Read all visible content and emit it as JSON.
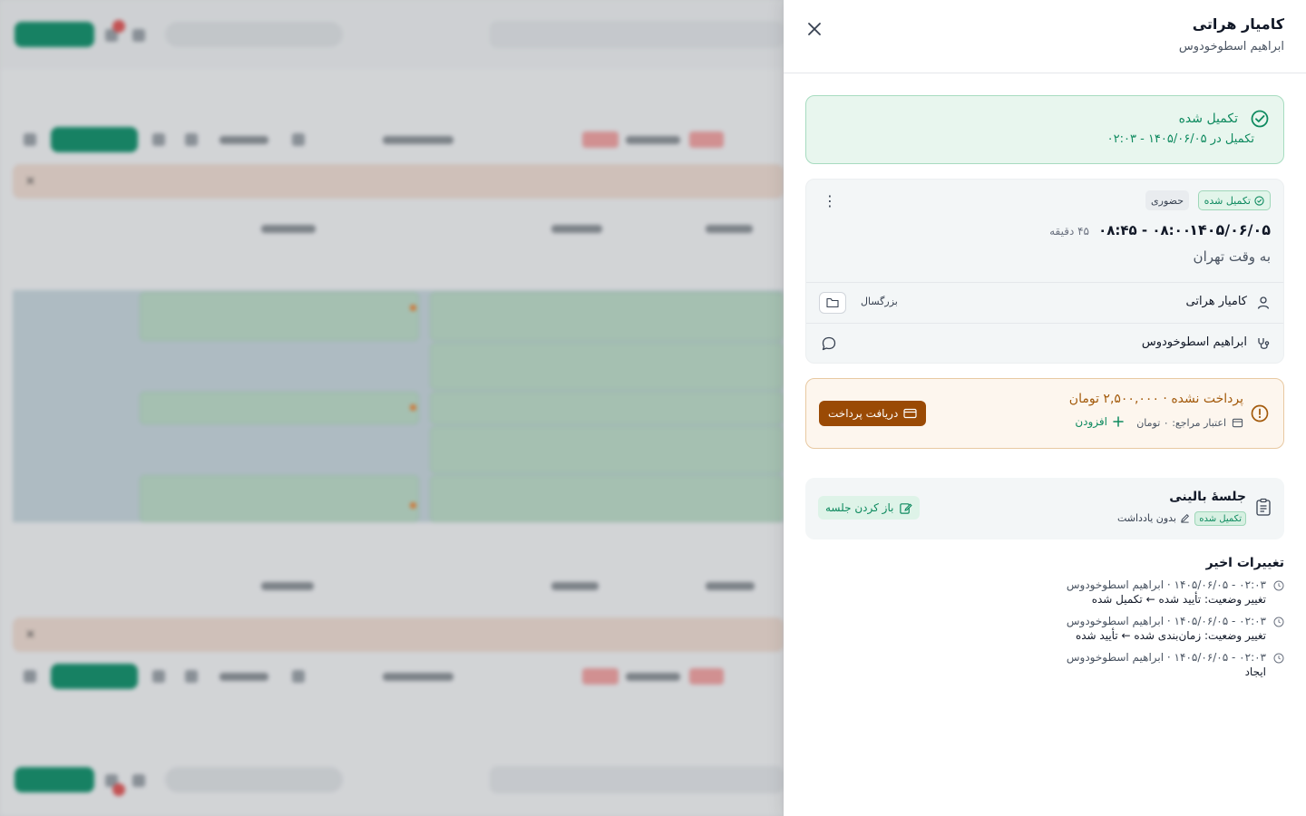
{
  "drawer": {
    "title": "کامیار هراتی",
    "subtitle": "ابراهیم اسطوخودوس"
  },
  "status": {
    "title": "تکمیل شده",
    "subtitle": "تکمیل در ۱۴۰۵/۰۶/۰۵ - ۰۲:۰۳",
    "color": "#0e8a5f"
  },
  "appointment": {
    "status_chip": "تکمیل شده",
    "type_chip": "حضوری",
    "date": "۱۴۰۵/۰۶/۰۵",
    "time": "۰۸:۰۰ - ۰۸:۴۵",
    "duration": "۴۵ دقیقه",
    "timezone": "به وقت تهران",
    "patient_name": "کامیار هراتی",
    "age_group": "بزرگسال",
    "therapist_name": "ابراهیم اسطوخودوس"
  },
  "payment": {
    "title": "پرداخت نشده · ۲,۵۰۰,۰۰۰ تومان",
    "credit": "اعتبار مراجع: ۰ تومان",
    "add_label": "افزودن",
    "receive_label": "دریافت پرداخت",
    "accent": "#9a4a05"
  },
  "session": {
    "title": "جلسهٔ بالینی",
    "status_chip": "تکمیل شده",
    "note": "بدون یادداشت",
    "open_label": "باز کردن جلسه"
  },
  "changes": {
    "title": "تغییرات اخیر",
    "items": [
      {
        "meta": "۰۲:۰۳ - ۱۴۰۵/۰۶/۰۵ · ابراهیم اسطوخودوس",
        "desc": "تغییر وضعیت: تأیید شده ← تکمیل شده"
      },
      {
        "meta": "۰۲:۰۳ - ۱۴۰۵/۰۶/۰۵ · ابراهیم اسطوخودوس",
        "desc": "تغییر وضعیت: زمان‌بندی شده ← تأیید شده"
      },
      {
        "meta": "۰۲:۰۳ - ۱۴۰۵/۰۶/۰۵ · ابراهیم اسطوخودوس",
        "desc": "ایجاد"
      }
    ]
  }
}
